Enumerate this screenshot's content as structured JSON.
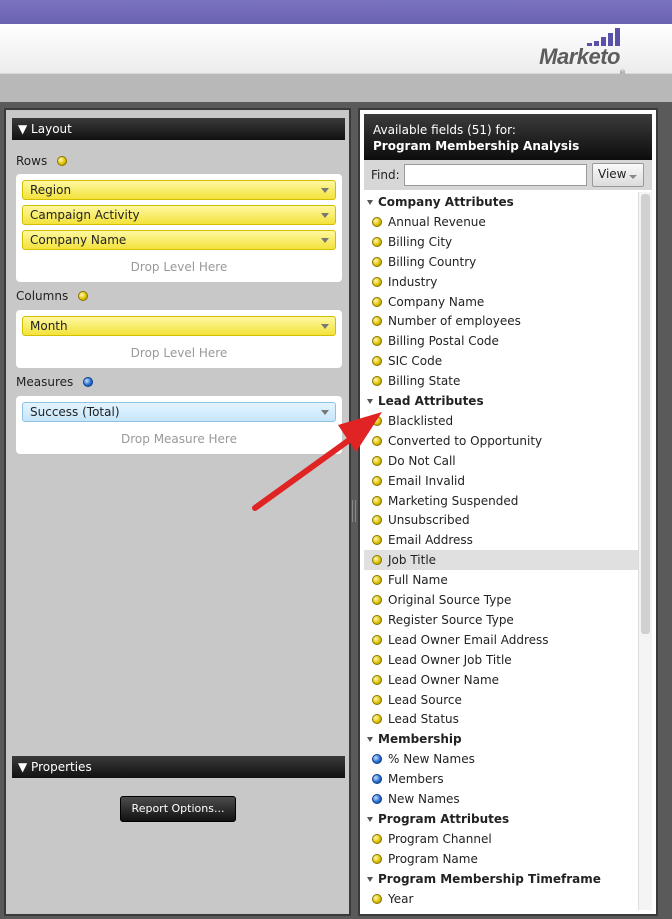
{
  "brand": {
    "name": "Marketo",
    "tm": "®"
  },
  "layout": {
    "title": "Layout",
    "rows_label": "Rows",
    "rows": [
      "Region",
      "Campaign Activity",
      "Company Name"
    ],
    "rows_drop": "Drop Level Here",
    "columns_label": "Columns",
    "columns": [
      "Month"
    ],
    "columns_drop": "Drop Level Here",
    "measures_label": "Measures",
    "measures": [
      "Success (Total)"
    ],
    "measures_drop": "Drop Measure Here"
  },
  "properties": {
    "title": "Properties",
    "report_options_label": "Report Options..."
  },
  "fields": {
    "header_line1": "Available fields (51) for:",
    "header_line2": "Program Membership Analysis",
    "find_label": "Find:",
    "find_value": "",
    "view_label": "View",
    "groups": [
      {
        "name": "Company Attributes",
        "items": [
          {
            "label": "Annual Revenue",
            "color": "yellow"
          },
          {
            "label": "Billing City",
            "color": "yellow"
          },
          {
            "label": "Billing Country",
            "color": "yellow"
          },
          {
            "label": "Industry",
            "color": "yellow"
          },
          {
            "label": "Company Name",
            "color": "yellow"
          },
          {
            "label": "Number of employees",
            "color": "yellow"
          },
          {
            "label": "Billing Postal Code",
            "color": "yellow"
          },
          {
            "label": "SIC Code",
            "color": "yellow"
          },
          {
            "label": "Billing State",
            "color": "yellow"
          }
        ]
      },
      {
        "name": "Lead Attributes",
        "items": [
          {
            "label": "Blacklisted",
            "color": "yellow"
          },
          {
            "label": "Converted to Opportunity",
            "color": "yellow"
          },
          {
            "label": "Do Not Call",
            "color": "yellow"
          },
          {
            "label": "Email Invalid",
            "color": "yellow"
          },
          {
            "label": "Marketing Suspended",
            "color": "yellow"
          },
          {
            "label": "Unsubscribed",
            "color": "yellow"
          },
          {
            "label": "Email Address",
            "color": "yellow"
          },
          {
            "label": "Job Title",
            "color": "yellow",
            "selected": true
          },
          {
            "label": "Full Name",
            "color": "yellow"
          },
          {
            "label": "Original Source Type",
            "color": "yellow"
          },
          {
            "label": "Register Source Type",
            "color": "yellow"
          },
          {
            "label": "Lead Owner Email Address",
            "color": "yellow"
          },
          {
            "label": "Lead Owner Job Title",
            "color": "yellow"
          },
          {
            "label": "Lead Owner Name",
            "color": "yellow"
          },
          {
            "label": "Lead Source",
            "color": "yellow"
          },
          {
            "label": "Lead Status",
            "color": "yellow"
          }
        ]
      },
      {
        "name": "Membership",
        "items": [
          {
            "label": "% New Names",
            "color": "blue"
          },
          {
            "label": "Members",
            "color": "blue"
          },
          {
            "label": "New Names",
            "color": "blue"
          }
        ]
      },
      {
        "name": "Program Attributes",
        "items": [
          {
            "label": "Program Channel",
            "color": "yellow"
          },
          {
            "label": "Program Name",
            "color": "yellow"
          }
        ]
      },
      {
        "name": "Program Membership Timeframe",
        "items": [
          {
            "label": "Year",
            "color": "yellow"
          }
        ]
      }
    ]
  },
  "colors": {
    "accent_bar": "#6b64b6",
    "annotation_arrow": "#e02424",
    "yellow_pill": "#f3e23c",
    "blue_pill": "#c6e6fb"
  }
}
